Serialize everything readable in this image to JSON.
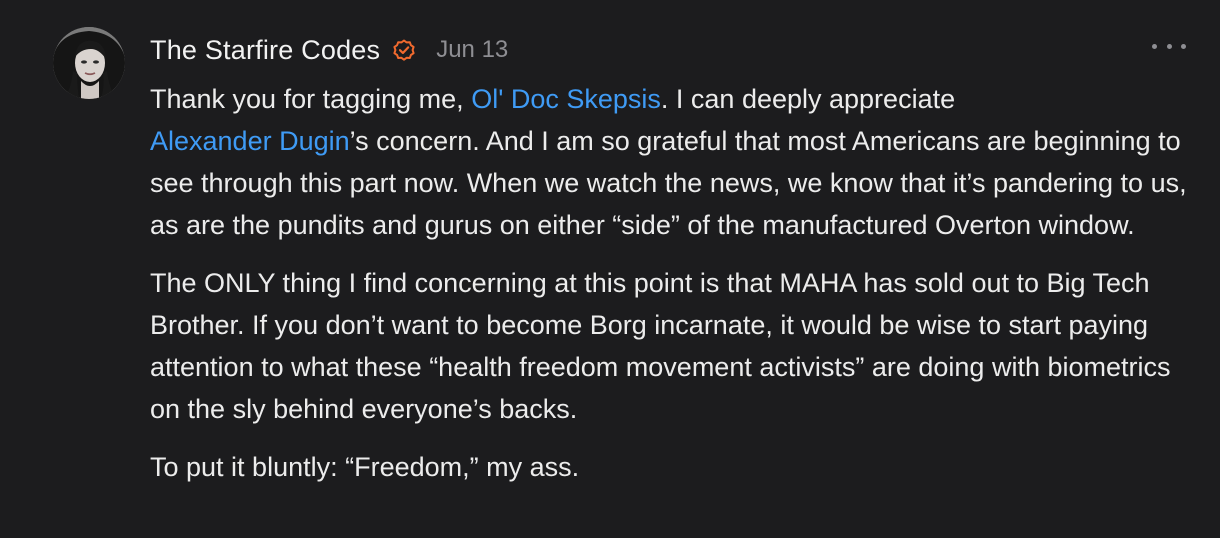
{
  "comment": {
    "author": "The Starfire Codes",
    "date": "Jun 13",
    "icons": {
      "verified": "verified-badge-icon",
      "more": "more-options-icon",
      "avatar": "user-avatar"
    },
    "colors": {
      "background": "#1c1c1e",
      "text": "#ececec",
      "link": "#3f9bf5",
      "badge": "#f26a2e",
      "muted": "#8e8e93"
    },
    "paragraph1": {
      "part1": "Thank you for tagging me, ",
      "mention1": "Ol' Doc Skepsis",
      "part2": ". I can deeply appreciate ",
      "mention2": "Alexander Dugin",
      "part3": "’s concern. And I am so grateful that most Americans are beginning to see through this part now. When we watch the news, we know that it’s pandering to us, as are the pundits and gurus on either “side” of the manufactured Overton window."
    },
    "paragraph2": "The ONLY thing I find concerning at this point is that MAHA has sold out to Big Tech Brother. If you don’t want to become Borg incarnate, it would be wise to start paying attention to what these “health freedom movement activists” are doing with biometrics on the sly behind everyone’s backs.",
    "paragraph3": "To put it bluntly: “Freedom,” my ass."
  }
}
